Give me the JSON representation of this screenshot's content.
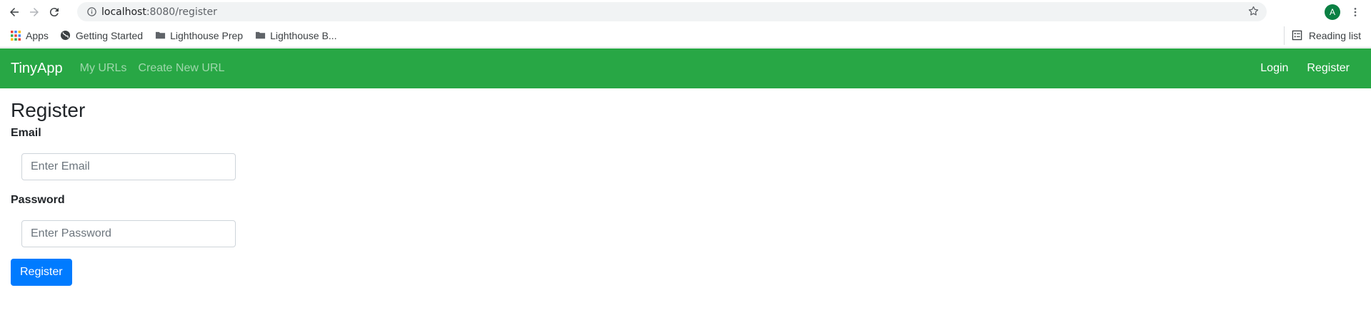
{
  "browser": {
    "url_host": "localhost",
    "url_path": ":8080/register",
    "avatar_letter": "A",
    "bookmarks": [
      {
        "label": "Apps"
      },
      {
        "label": "Getting Started"
      },
      {
        "label": "Lighthouse Prep"
      },
      {
        "label": "Lighthouse B..."
      }
    ],
    "reading_list": "Reading list"
  },
  "navbar": {
    "brand": "TinyApp",
    "links": [
      {
        "label": "My URLs"
      },
      {
        "label": "Create New URL"
      }
    ],
    "right_links": [
      {
        "label": "Login"
      },
      {
        "label": "Register"
      }
    ],
    "color": "#28a745"
  },
  "form": {
    "title": "Register",
    "email_label": "Email",
    "email_placeholder": "Enter Email",
    "password_label": "Password",
    "password_placeholder": "Enter Password",
    "submit_label": "Register",
    "submit_color": "#007bff"
  }
}
